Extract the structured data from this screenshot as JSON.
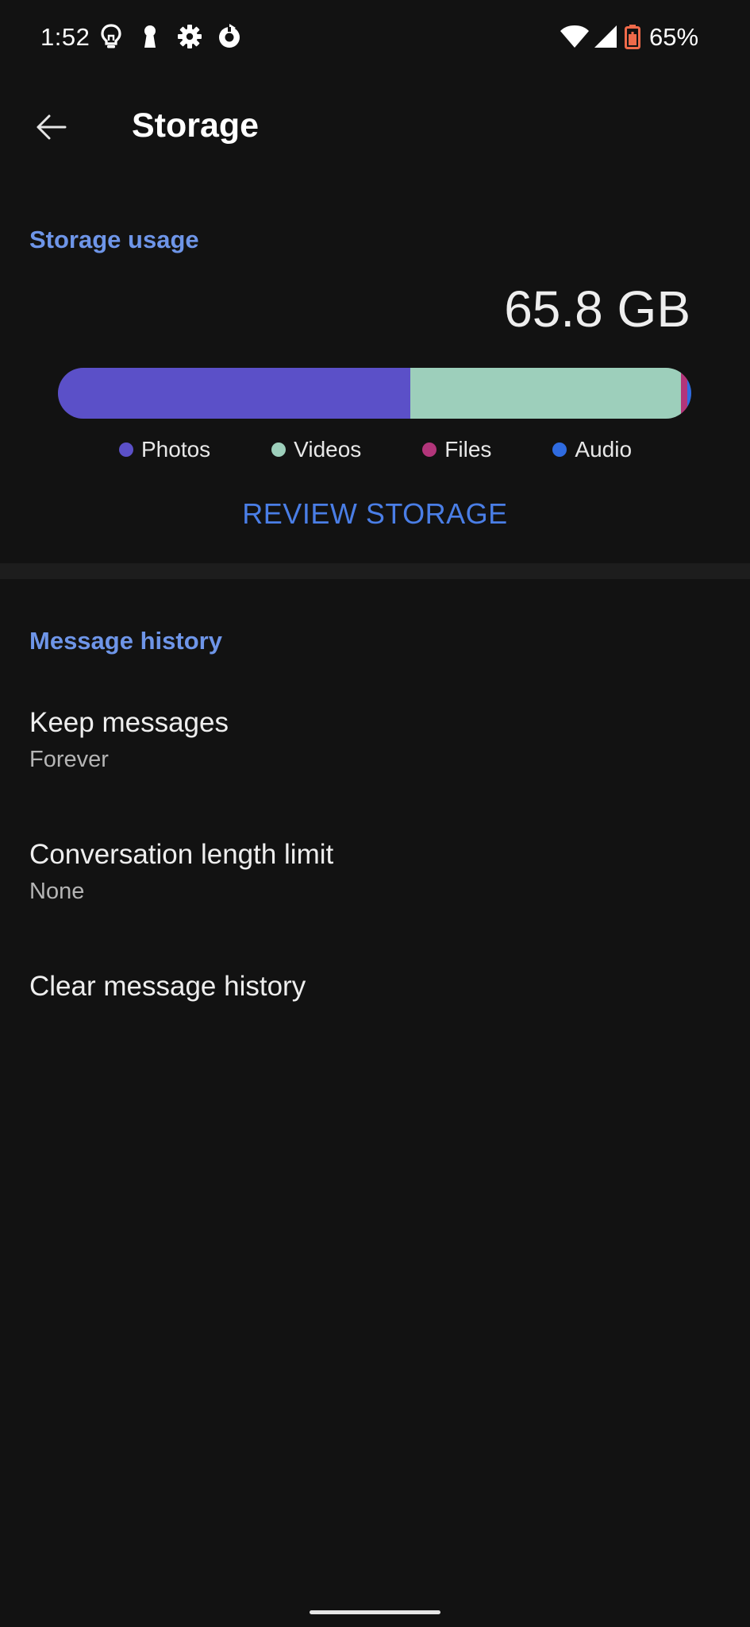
{
  "status_bar": {
    "time": "1:52",
    "battery_percent": "65%",
    "icons": [
      "lightbulb-icon",
      "keyhole-icon",
      "settings-gear-icon",
      "refresh-app-icon",
      "wifi-icon",
      "cell-signal-icon",
      "battery-icon"
    ],
    "battery_color": "#f06a4a"
  },
  "toolbar": {
    "title": "Storage"
  },
  "storage_usage": {
    "header": "Storage usage",
    "total": "65.8 GB",
    "segments": [
      {
        "name": "Photos",
        "fraction": 0.557,
        "color": "#5b50c8"
      },
      {
        "name": "Videos",
        "fraction": 0.427,
        "color": "#9dcfbb"
      },
      {
        "name": "Files",
        "fraction": 0.01,
        "color": "#b2357a"
      },
      {
        "name": "Audio",
        "fraction": 0.006,
        "color": "#2f6be0"
      }
    ],
    "legend": {
      "photos": "Photos",
      "videos": "Videos",
      "files": "Files",
      "audio": "Audio"
    },
    "review_label": "REVIEW STORAGE"
  },
  "message_history": {
    "header": "Message history",
    "keep_messages": {
      "title": "Keep messages",
      "value": "Forever"
    },
    "length_limit": {
      "title": "Conversation length limit",
      "value": "None"
    },
    "clear": {
      "title": "Clear message history"
    }
  },
  "colors": {
    "accent": "#6e95e8",
    "background": "#121212",
    "divider": "#1d1d1d"
  }
}
